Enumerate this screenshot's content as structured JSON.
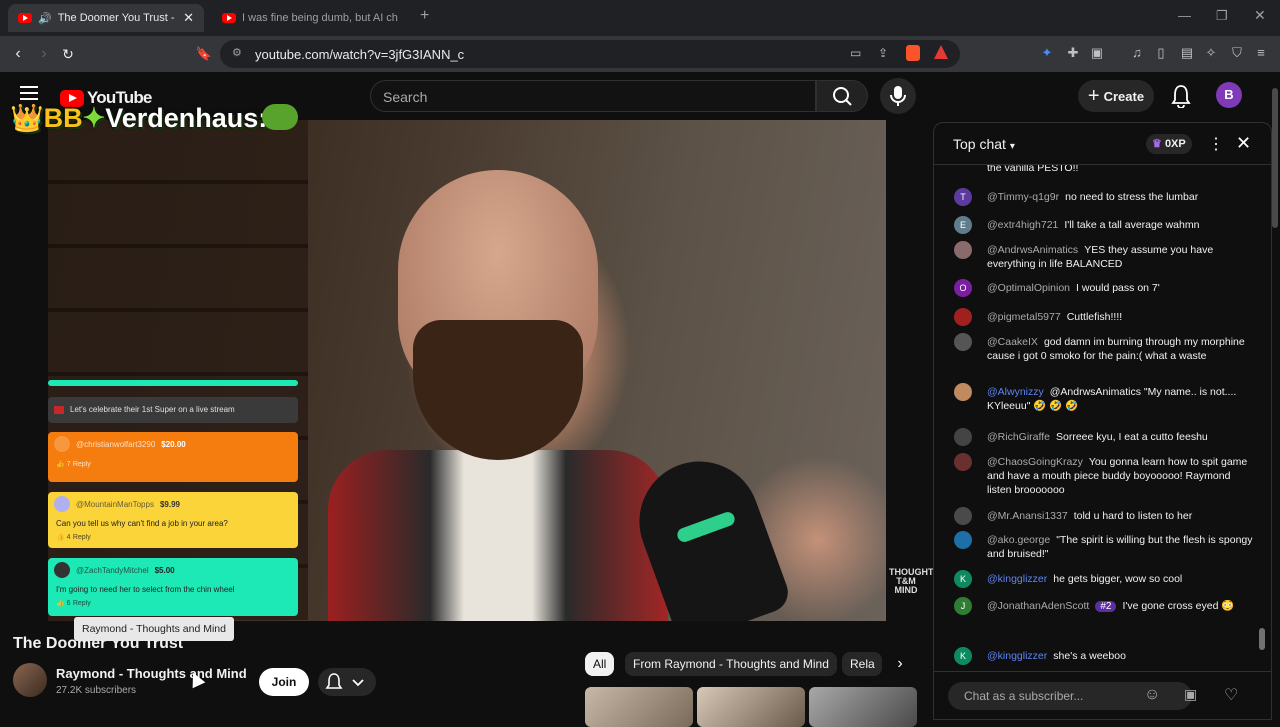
{
  "browser": {
    "tabs": [
      {
        "title": "The Doomer You Trust - YouTube",
        "active": true
      },
      {
        "title": "I was fine being dumb, but AI changed",
        "active": false
      }
    ],
    "url": "youtube.com/watch?v=3jfG3IANN_c"
  },
  "header": {
    "logo_text": "YouTube",
    "search_placeholder": "Search",
    "create_label": "Create",
    "avatar_letter": "B"
  },
  "video": {
    "overlay_title_crown": "👑",
    "overlay_title_prefix": "BB",
    "overlay_title_name": "Verdenhaus:",
    "watermark": "THOUGHTS T&M MIND",
    "superchats": {
      "banner": "Let's celebrate their 1st Super on a live stream",
      "items": [
        {
          "name": "@christianwolfart3290",
          "amount": "$20.00",
          "message": "",
          "likes": "7",
          "reply": "Reply",
          "color": "#f57d0f"
        },
        {
          "name": "@MountainManTopps",
          "amount": "$9.99",
          "message": "Can you tell us why can't find a job in your area?",
          "likes": "4",
          "reply": "Reply",
          "color": "#fbd43a"
        },
        {
          "name": "@ZachTandyMitchel",
          "amount": "$5.00",
          "message": "I'm going to need her to select from the chin wheel",
          "likes": "6",
          "reply": "Reply",
          "color": "#1de9b6"
        }
      ]
    }
  },
  "below": {
    "tooltip": "Raymond - Thoughts and Mind",
    "title": "The Doomer You Trust",
    "channel_name": "Raymond - Thoughts and Mind",
    "subscribers": "27.2K subscribers",
    "join_label": "Join"
  },
  "chips": [
    "All",
    "From Raymond - Thoughts and Mind",
    "Rela"
  ],
  "chat": {
    "title": "Top chat",
    "xp_badge": "0XP",
    "partial_top": "the vanilla PESTO!!",
    "messages": [
      {
        "author": "@Timmy-q1g9r",
        "text": "no need to stress the lumbar",
        "avatar": "T",
        "color": "#5c3a9e",
        "mod": false
      },
      {
        "author": "@extr4high721",
        "text": "I'll take a tall average wahmn",
        "avatar": "E",
        "color": "#607d8b",
        "mod": false
      },
      {
        "author": "@AndrwsAnimatics",
        "text": "YES they assume you have everything in life BALANCED",
        "avatar": "",
        "color": "#8a6a6a",
        "mod": false
      },
      {
        "author": "@OptimalOpinion",
        "text": "I would pass on 7'",
        "avatar": "O",
        "color": "#7b1fa2",
        "mod": false
      },
      {
        "author": "@pigmetal5977",
        "text": "Cuttlefish!!!!",
        "avatar": "",
        "color": "#a02020",
        "mod": false
      },
      {
        "author": "@CaakeIX",
        "text": "god damn im burning through my morphine cause i got 0 smoko for the pain:( what a waste",
        "avatar": "",
        "color": "#555555",
        "mod": false
      },
      {
        "author": "@Alwynizzy",
        "text": "@AndrwsAnimatics \"My name.. is not.... KYleeuu\" 🤣 🤣 🤣",
        "avatar": "",
        "color": "#c08a60",
        "mod": true
      },
      {
        "author": "@RichGiraffe",
        "text": "Sorreee kyu, I eat a cutto feeshu",
        "avatar": "",
        "color": "#444444",
        "mod": false
      },
      {
        "author": "@ChaosGoingKrazy",
        "text": "You gonna learn how to spit game and have a mouth piece buddy boyooooo! Raymond listen brooooooo",
        "avatar": "",
        "color": "#6a3030",
        "mod": false
      },
      {
        "author": "@Mr.Anansi1337",
        "text": "told u hard to listen to her",
        "avatar": "",
        "color": "#4a4a4a",
        "mod": false
      },
      {
        "author": "@ako.george",
        "text": "\"The spirit is willing but the flesh is spongy and bruised!\"",
        "avatar": "",
        "color": "#1e6fa8",
        "mod": false
      },
      {
        "author": "@kingglizzer",
        "text": "he gets bigger, wow so cool",
        "avatar": "K",
        "color": "#0e8a5f",
        "mod": true
      },
      {
        "author": "@JonathanAdenScott",
        "text": "I've gone cross eyed 😳",
        "avatar": "J",
        "color": "#2e7d32",
        "mod": false,
        "badge": "#2"
      },
      {
        "author": "@kingglizzer",
        "text": "she's a weeboo",
        "avatar": "K",
        "color": "#0e8a5f",
        "mod": true
      }
    ],
    "input_placeholder": "Chat as a subscriber..."
  }
}
